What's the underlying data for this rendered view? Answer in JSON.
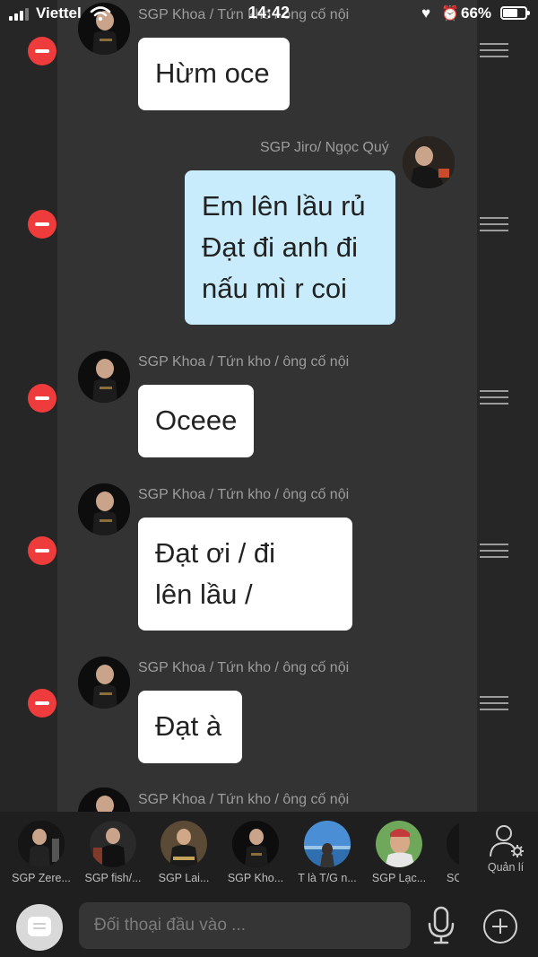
{
  "status_bar": {
    "carrier": "Viettel",
    "time": "14:42",
    "battery_percent": "66%",
    "battery_level": 0.66,
    "icons": [
      "signal-icon",
      "wifi-icon",
      "heart-icon",
      "alarm-icon",
      "battery-icon"
    ]
  },
  "messages": [
    {
      "sender": "SGP Khoa / Tứn kho / ông cố nội",
      "lines": [
        "Hừm oce"
      ],
      "direction": "incoming"
    },
    {
      "sender": "SGP Jiro/ Ngọc Quý",
      "lines": [
        "Em lên lầu rủ",
        "Đạt đi anh đi",
        "nấu mì r coi"
      ],
      "direction": "outgoing"
    },
    {
      "sender": "SGP Khoa / Tứn kho / ông cố nội",
      "lines": [
        "Oceee"
      ],
      "direction": "incoming"
    },
    {
      "sender": "SGP Khoa / Tứn kho / ông cố nội",
      "lines": [
        "Đạt ơi / đi",
        "lên lầu /"
      ],
      "direction": "incoming"
    },
    {
      "sender": "SGP Khoa / Tứn kho / ông cố nội",
      "lines": [
        "Đạt à"
      ],
      "direction": "incoming"
    },
    {
      "sender": "SGP Khoa / Tứn kho / ông cố nội",
      "lines": [],
      "direction": "incoming"
    }
  ],
  "dock": {
    "members": [
      {
        "label": "SGP Zere..."
      },
      {
        "label": "SGP fish/..."
      },
      {
        "label": "SGP Lai..."
      },
      {
        "label": "SGP Kho..."
      },
      {
        "label": "T là T/G n..."
      },
      {
        "label": "SGP Lạc..."
      },
      {
        "label": "SC"
      }
    ],
    "manage_label": "Quản lí"
  },
  "composer": {
    "placeholder": "Đối thoại đầu vào ..."
  },
  "colors": {
    "incoming_bubble": "#ffffff",
    "outgoing_bubble": "#c8ecfb",
    "delete_red": "#ee3b3b"
  }
}
